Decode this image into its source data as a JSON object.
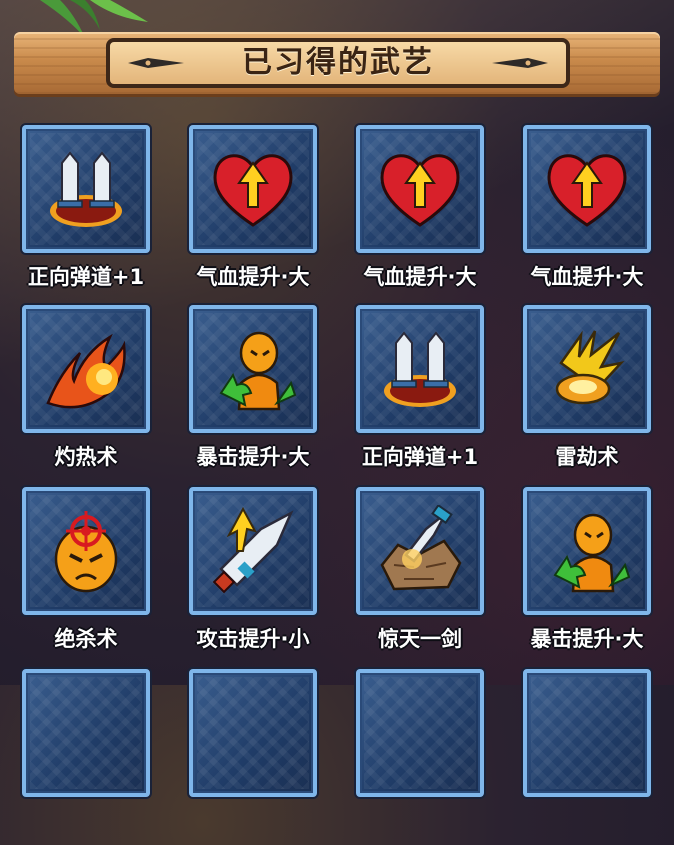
{
  "title": "已习得的武艺",
  "colors": {
    "frame": "#7fb6ea",
    "tile": "#2a4a7a",
    "banner": "#d39b5e"
  },
  "skills": [
    {
      "name": "正向弹道+1",
      "icon": "twin-blades-icon"
    },
    {
      "name": "气血提升·大",
      "icon": "heart-arrow-icon"
    },
    {
      "name": "气血提升·大",
      "icon": "heart-arrow-icon"
    },
    {
      "name": "气血提升·大",
      "icon": "heart-arrow-icon"
    },
    {
      "name": "灼热术",
      "icon": "fireball-icon"
    },
    {
      "name": "暴击提升·大",
      "icon": "crit-up-icon"
    },
    {
      "name": "正向弹道+1",
      "icon": "twin-blades-icon"
    },
    {
      "name": "雷劫术",
      "icon": "lightning-icon"
    },
    {
      "name": "绝杀术",
      "icon": "target-face-icon"
    },
    {
      "name": "攻击提升·小",
      "icon": "sword-up-icon"
    },
    {
      "name": "惊天一剑",
      "icon": "sword-rock-icon"
    },
    {
      "name": "暴击提升·大",
      "icon": "crit-up-icon"
    }
  ]
}
